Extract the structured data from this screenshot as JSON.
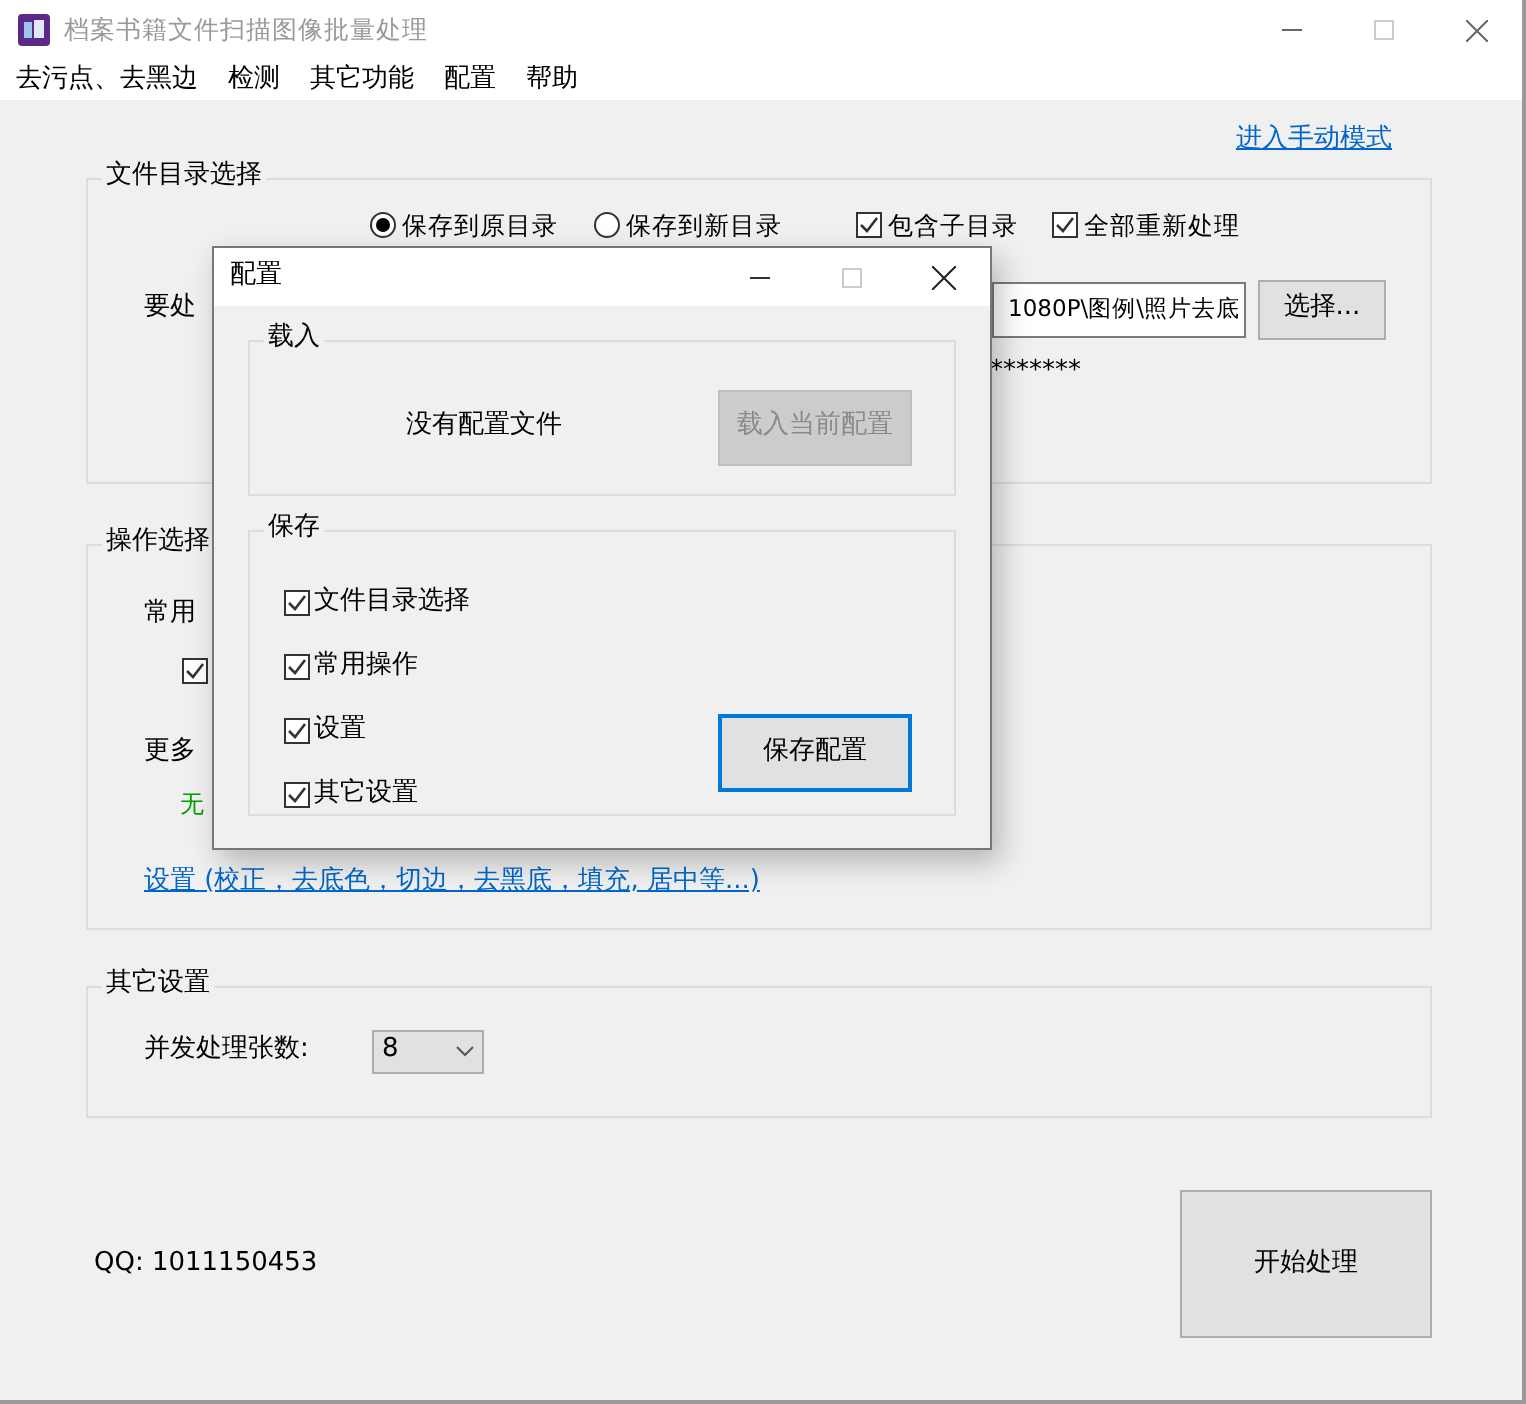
{
  "window": {
    "title": "档案书籍文件扫描图像批量处理"
  },
  "menu": [
    "去污点、去黑边",
    "检测",
    "其它功能",
    "配置",
    "帮助"
  ],
  "manual_mode_link": "进入手动模式",
  "file_dir_group": {
    "title": "文件目录选择",
    "save_options": [
      {
        "label": "保存到原目录",
        "selected": true
      },
      {
        "label": "保存到新目录",
        "selected": false
      }
    ],
    "include_subdirs": {
      "label": "包含子目录",
      "checked": true
    },
    "reprocess_all": {
      "label": "全部重新处理",
      "checked": true
    },
    "dir_label": "要处",
    "path_value": "1080P\\图例\\照片去底",
    "browse_button": "选择...",
    "masked_text": "*******"
  },
  "operations_group": {
    "title": "操作选择",
    "common_label": "常用",
    "common_checkbox": {
      "checked": true
    },
    "more_label": "更多",
    "more_value": "无",
    "settings_link": "设置 (校正，去底色，切边，去黑底，填充, 居中等...)"
  },
  "other_settings_group": {
    "title": "其它设置",
    "concurrency_label": "并发处理张数:",
    "concurrency_value": "8"
  },
  "qq": "QQ: 1011150453",
  "start_button": "开始处理",
  "dialog": {
    "title": "配置",
    "load_group": {
      "title": "载入",
      "message": "没有配置文件",
      "load_button": {
        "label": "载入当前配置",
        "disabled": true
      }
    },
    "save_group": {
      "title": "保存",
      "items": [
        {
          "label": "文件目录选择",
          "checked": true
        },
        {
          "label": "常用操作",
          "checked": true
        },
        {
          "label": "设置",
          "checked": true
        },
        {
          "label": "其它设置",
          "checked": true
        }
      ],
      "save_button": {
        "label": "保存配置",
        "focused": true
      }
    }
  }
}
